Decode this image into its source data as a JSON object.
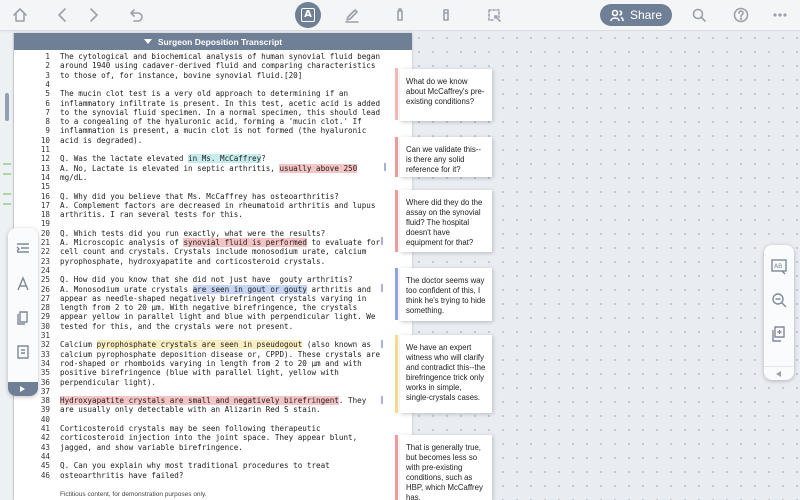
{
  "toolbar": {
    "share_label": "Share",
    "active_tool_glyph": "A",
    "icons": [
      "home-icon",
      "back-arrow-icon",
      "forward-arrow-icon",
      "undo-icon",
      "text-tool-icon",
      "pen-icon",
      "highlighter-icon",
      "marker-icon",
      "lasso-icon",
      "share-people-icon",
      "search-icon",
      "help-icon",
      "more-icon"
    ]
  },
  "document": {
    "title": "Surgeon Deposition Transcript",
    "lines": [
      {
        "n": "1",
        "segments": [
          {
            "t": "The cytological and biochemical analysis of human synovial fluid began"
          }
        ]
      },
      {
        "n": "2",
        "segments": [
          {
            "t": "around 1940 using cadaver-derived fluid and comparing characteristics"
          }
        ]
      },
      {
        "n": "3",
        "segments": [
          {
            "t": "to those of, for instance, bovine synovial fluid.[20]"
          }
        ]
      },
      {
        "n": "4",
        "segments": [
          {
            "t": ""
          }
        ]
      },
      {
        "n": "5",
        "segments": [
          {
            "t": "The mucin clot test is a very old approach to determining if an"
          }
        ]
      },
      {
        "n": "6",
        "segments": [
          {
            "t": "inflammatory infiltrate is present. In this test, acetic acid is added"
          }
        ]
      },
      {
        "n": "7",
        "segments": [
          {
            "t": "to the synovial fluid specimen. In a normal specimen, this should lead"
          }
        ]
      },
      {
        "n": "8",
        "segments": [
          {
            "t": "to a congealing of the hyaluronic acid, forming a 'mucin clot.' If"
          }
        ]
      },
      {
        "n": "9",
        "segments": [
          {
            "t": "inflammation is present, a mucin clot is not formed (the hyaluronic"
          }
        ]
      },
      {
        "n": "10",
        "segments": [
          {
            "t": "acid is degraded)."
          }
        ]
      },
      {
        "n": "11",
        "segments": [
          {
            "t": ""
          }
        ]
      },
      {
        "n": "12",
        "segments": [
          {
            "t": "Q. Was the lactate elevated "
          },
          {
            "t": "in Ms. McCaffrey",
            "hl": "teal"
          },
          {
            "t": "?"
          }
        ]
      },
      {
        "n": "13",
        "segments": [
          {
            "t": "A. No, Lactate is elevated in septic arthritis, "
          },
          {
            "t": "usually above 250",
            "hl": "red"
          }
        ]
      },
      {
        "n": "14",
        "segments": [
          {
            "t": "mg/dL."
          }
        ]
      },
      {
        "n": "15",
        "segments": [
          {
            "t": ""
          }
        ]
      },
      {
        "n": "16",
        "segments": [
          {
            "t": "Q. Why did you believe that Ms. McCaffrey has osteoarthritis?"
          }
        ]
      },
      {
        "n": "17",
        "segments": [
          {
            "t": "A. Complement factors are decreased in rheumatoid arthritis and lupus"
          }
        ]
      },
      {
        "n": "18",
        "segments": [
          {
            "t": "arthritis. I ran several tests for this."
          }
        ]
      },
      {
        "n": "19",
        "segments": [
          {
            "t": ""
          }
        ]
      },
      {
        "n": "20",
        "segments": [
          {
            "t": "Q. Which tests did you run exactly, what were the results?"
          }
        ]
      },
      {
        "n": "21",
        "segments": [
          {
            "t": "A. Microscopic analysis of "
          },
          {
            "t": "synovial fluid is performed",
            "hl": "red"
          },
          {
            "t": " to evaluate for"
          }
        ]
      },
      {
        "n": "22",
        "segments": [
          {
            "t": "cell count and crystals. Crystals include monosodium urate, calcium"
          }
        ]
      },
      {
        "n": "23",
        "segments": [
          {
            "t": "pyrophosphate, hydroxyapatite and corticosteroid crystals."
          }
        ]
      },
      {
        "n": "24",
        "segments": [
          {
            "t": ""
          }
        ]
      },
      {
        "n": "25",
        "segments": [
          {
            "t": "Q. How did you know that she did not just have  gouty arthritis?"
          }
        ]
      },
      {
        "n": "26",
        "segments": [
          {
            "t": "A. Monosodium urate crystals "
          },
          {
            "t": "are seen in gout or gouty",
            "hl": "blue"
          },
          {
            "t": " arthritis and"
          }
        ]
      },
      {
        "n": "27",
        "segments": [
          {
            "t": "appear as needle-shaped negatively birefringent crystals varying in"
          }
        ]
      },
      {
        "n": "28",
        "segments": [
          {
            "t": "length from 2 to 20 μm. With negative birefringence, the crystals"
          }
        ]
      },
      {
        "n": "29",
        "segments": [
          {
            "t": "appear yellow in parallel light and blue with perpendicular light. We"
          }
        ]
      },
      {
        "n": "30",
        "segments": [
          {
            "t": "tested for this, and the crystals were not present."
          }
        ]
      },
      {
        "n": "31",
        "segments": [
          {
            "t": ""
          }
        ]
      },
      {
        "n": "32",
        "segments": [
          {
            "t": "Calcium "
          },
          {
            "t": "pyrophosphate crystals are seen in pseudogout",
            "hl": "yellow"
          },
          {
            "t": " (also known as"
          }
        ]
      },
      {
        "n": "33",
        "segments": [
          {
            "t": "calcium pyrophosphate deposition disease or, CPPD). These crystals are"
          }
        ]
      },
      {
        "n": "34",
        "segments": [
          {
            "t": "rod-shaped or rhomboids varying in length from 2 to 20 μm and with"
          }
        ]
      },
      {
        "n": "35",
        "segments": [
          {
            "t": "positive birefringence (blue with parallel light, yellow with"
          }
        ]
      },
      {
        "n": "36",
        "segments": [
          {
            "t": "perpendicular light)."
          }
        ]
      },
      {
        "n": "37",
        "segments": [
          {
            "t": ""
          }
        ]
      },
      {
        "n": "38",
        "segments": [
          {
            "t": "Hydroxyapatite crystals are small and negatively birefringent",
            "hl": "red"
          },
          {
            "t": ". They"
          }
        ]
      },
      {
        "n": "39",
        "segments": [
          {
            "t": "are usually only detectable with an Alizarin Red S stain."
          }
        ]
      },
      {
        "n": "40",
        "segments": [
          {
            "t": ""
          }
        ]
      },
      {
        "n": "41",
        "segments": [
          {
            "t": "Corticosteroid crystals may be seen following therapeutic"
          }
        ]
      },
      {
        "n": "42",
        "segments": [
          {
            "t": "corticosteroid injection into the joint space. They appear blunt,"
          }
        ]
      },
      {
        "n": "43",
        "segments": [
          {
            "t": "jagged, and show variable birefringence."
          }
        ]
      },
      {
        "n": "44",
        "segments": [
          {
            "t": ""
          }
        ]
      },
      {
        "n": "45",
        "segments": [
          {
            "t": "Q. Can you explain why most traditional procedures to treat"
          }
        ]
      },
      {
        "n": "46",
        "segments": [
          {
            "t": "osteoarthritis have failed?"
          }
        ]
      }
    ],
    "footer": "Fictitious content, for demonstration purposes only."
  },
  "notes": [
    {
      "text": "What do we know about McCaffrey's pre-existing conditions?",
      "color": "#f2b6b6"
    },
    {
      "text": "Can we validate this--is there any solid reference for it?",
      "color": "#ee9b9b"
    },
    {
      "text": "Where did they do the assay on the synovial fluid? The hospital doesn't have equipment for that?",
      "color": "#ee9b9b"
    },
    {
      "text": "The doctor seems way too confident of this, I think he's trying to hide something.",
      "color": "#8fa3e0"
    },
    {
      "text": "We have an expert witness who will clarify and contradict this--the birefringence trick only works in simple, single-crystals cases.",
      "color": "#f3dd8a"
    },
    {
      "text": "That is generally true, but becomes less so with pre-existing conditions, such as HBP, which McCaffrey has.",
      "color": "#ee9b9b"
    }
  ],
  "right_palette": {
    "icons": [
      "text-box-icon",
      "zoom-out-icon",
      "add-page-icon"
    ],
    "text_box_glyph": "AB"
  }
}
